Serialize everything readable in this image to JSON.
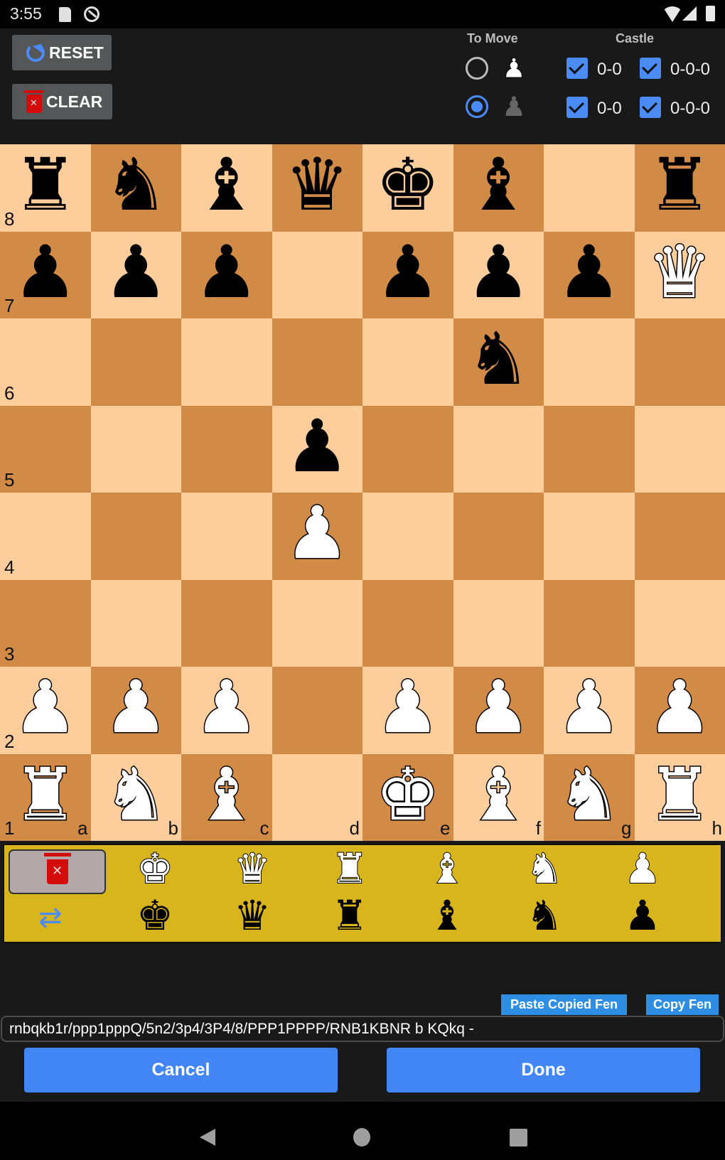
{
  "status_bar": {
    "time": "3:55",
    "icons": [
      "sd-card-icon",
      "sync-icon",
      "wifi-icon",
      "signal-icon",
      "battery-icon"
    ]
  },
  "controls": {
    "reset_label": "RESET",
    "clear_label": "CLEAR",
    "to_move_header": "To Move",
    "castle_header": "Castle",
    "to_move": {
      "white_selected": false,
      "black_selected": true,
      "white_pawn": "♟",
      "black_pawn": "♟"
    },
    "castle": {
      "white_kingside": {
        "label": "0-0",
        "checked": true
      },
      "white_queenside": {
        "label": "0-0-0",
        "checked": true
      },
      "black_kingside": {
        "label": "0-0",
        "checked": true
      },
      "black_queenside": {
        "label": "0-0-0",
        "checked": true
      }
    }
  },
  "board": {
    "colors": {
      "light": "#fdcd9c",
      "dark": "#d28b47"
    },
    "ranks": [
      "8",
      "7",
      "6",
      "5",
      "4",
      "3",
      "2",
      "1"
    ],
    "files": [
      "a",
      "b",
      "c",
      "d",
      "e",
      "f",
      "g",
      "h"
    ],
    "position": [
      [
        "bR",
        "bN",
        "bB",
        "bQ",
        "bK",
        "bB",
        "",
        "bR"
      ],
      [
        "bP",
        "bP",
        "bP",
        "",
        "bP",
        "bP",
        "bP",
        "wQ"
      ],
      [
        "",
        "",
        "",
        "",
        "",
        "bN",
        "",
        ""
      ],
      [
        "",
        "",
        "",
        "bP",
        "",
        "",
        "",
        ""
      ],
      [
        "",
        "",
        "",
        "wP",
        "",
        "",
        "",
        ""
      ],
      [
        "",
        "",
        "",
        "",
        "",
        "",
        "",
        ""
      ],
      [
        "wP",
        "wP",
        "wP",
        "",
        "wP",
        "wP",
        "wP",
        "wP"
      ],
      [
        "wR",
        "wN",
        "wB",
        "",
        "wK",
        "wB",
        "wN",
        "wR"
      ]
    ]
  },
  "glyphs": {
    "K": "♚",
    "Q": "♛",
    "R": "♜",
    "B": "♝",
    "N": "♞",
    "P": "♟"
  },
  "palette": {
    "background": "#d9b51d",
    "white_pieces": [
      "K",
      "Q",
      "R",
      "B",
      "N",
      "P"
    ],
    "black_pieces": [
      "K",
      "Q",
      "R",
      "B",
      "N",
      "P"
    ],
    "swap_icon": "⇄"
  },
  "fen": {
    "paste_label": "Paste Copied Fen",
    "copy_label": "Copy Fen",
    "value": "rnbqkb1r/ppp1pppQ/5n2/3p4/3P4/8/PPP1PPPP/RNB1KBNR b KQkq -"
  },
  "actions": {
    "cancel_label": "Cancel",
    "done_label": "Done",
    "accent": "#4285f4"
  }
}
